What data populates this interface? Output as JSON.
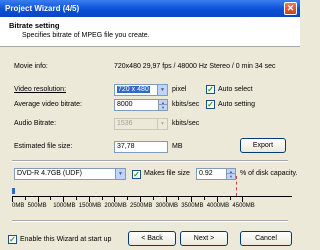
{
  "window": {
    "title": "Project Wizard (4/5)",
    "close_glyph": "✕"
  },
  "header": {
    "title": "Bitrate setting",
    "subtitle": "Specifies bitrate of MPEG file you create."
  },
  "movie_info": {
    "label": "Movie info:",
    "value": "720x480 29,97 fps / 48000 Hz Stereo / 0 min 34 sec"
  },
  "video_resolution": {
    "label": "Video resolution:",
    "value": "720 x 480",
    "unit": "pixel"
  },
  "avg_video_bitrate": {
    "label": "Average video bitrate:",
    "value": "8000",
    "unit": "kbits/sec"
  },
  "audio_bitrate": {
    "label": "Audio Bitrate:",
    "value": "1536",
    "unit": "kbits/sec"
  },
  "estimated_file_size": {
    "label": "Estimated file size:",
    "value": "37,78",
    "unit": "MB"
  },
  "auto_select": {
    "label": "Auto select",
    "checked": true
  },
  "auto_setting": {
    "label": "Auto setting",
    "checked": true
  },
  "export_button": {
    "label": "Export"
  },
  "disc": {
    "value": "DVD-R 4.7GB (UDF)",
    "makes_file_size_label": "Makes file size",
    "percent": "0.92",
    "percent_label": "% of disk capacity."
  },
  "ruler": {
    "labels": [
      "0MB",
      "500MB",
      "1000MB",
      "1500MB",
      "2000MB",
      "2500MB",
      "3000MB",
      "3500MB",
      "4000MB",
      "4500MB"
    ],
    "used_fraction": 0.0092
  },
  "footer": {
    "enable_wizard": {
      "label": "Enable this Wizard at start up",
      "checked": true
    },
    "back_label": "< Back",
    "next_label": "Next >",
    "cancel_label": "Cancel"
  },
  "colors": {
    "titlebar": "#0a50d8",
    "selection": "#316ac5",
    "check": "#21a121"
  },
  "icons": {
    "dropdown": "chevron-down-icon",
    "spin": "spin-arrows-icon",
    "check": "checkmark-icon"
  }
}
